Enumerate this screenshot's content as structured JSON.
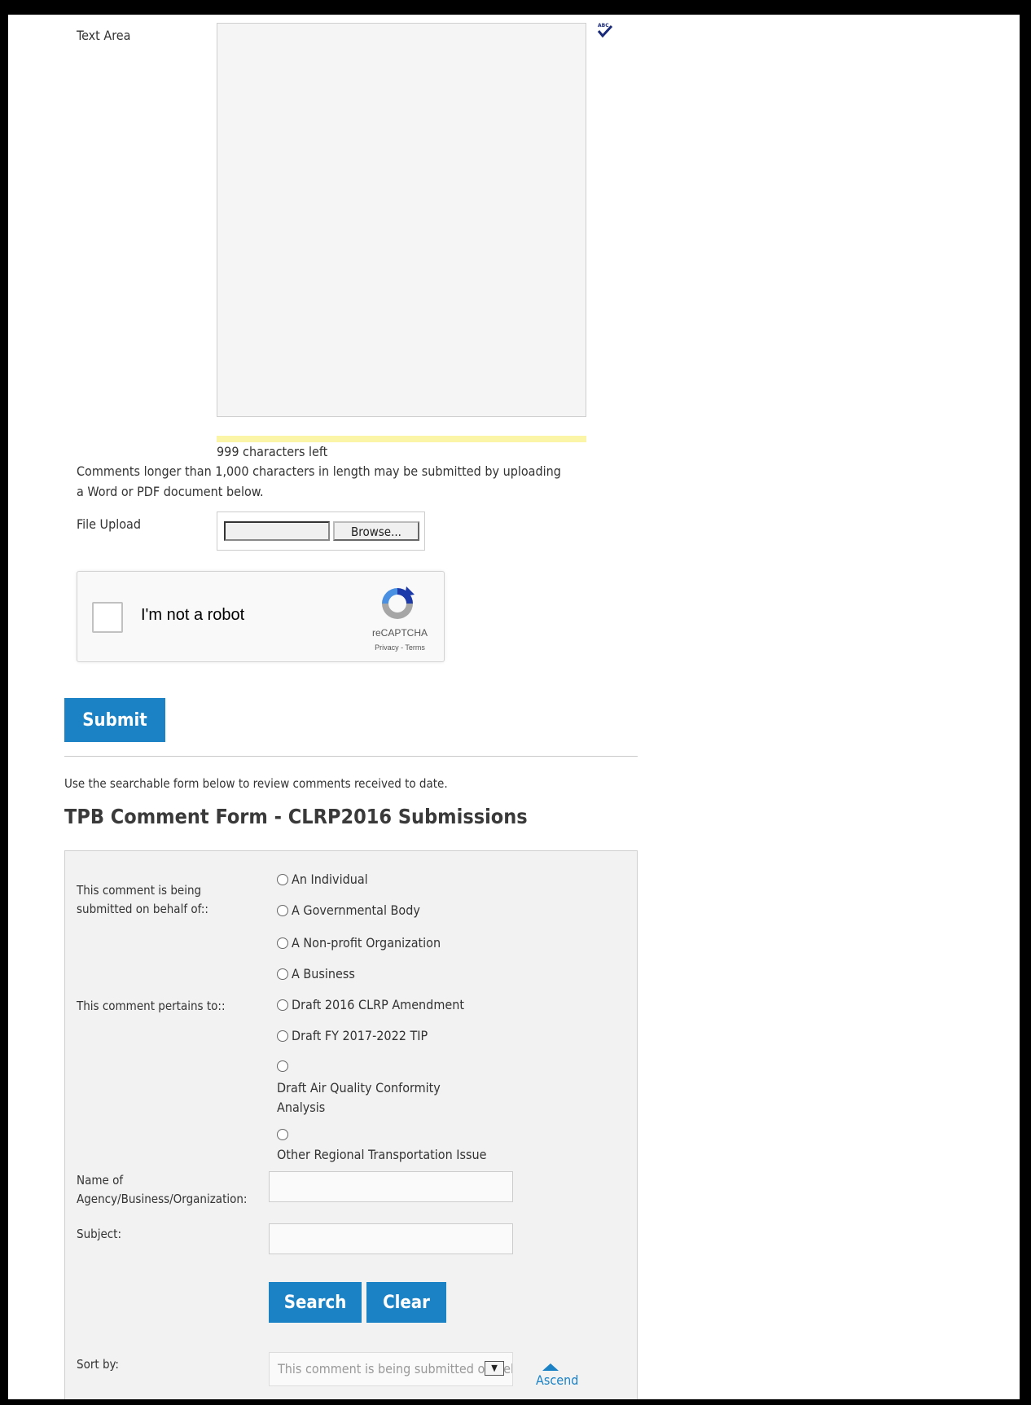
{
  "text_area": {
    "label": "Text Area",
    "value": ""
  },
  "spellcheck_icon": {
    "name": "spellcheck-icon",
    "glyph": "ABC✓"
  },
  "char_counter": "999 characters left",
  "long_comment_note": "Comments longer than 1,000 characters in length may be submitted by uploading a Word or PDF document below.",
  "file_upload": {
    "label": "File Upload",
    "browse_label": "Browse...",
    "value": ""
  },
  "recaptcha": {
    "checkbox_label": "I'm not a robot",
    "brand": "reCAPTCHA",
    "links": "Privacy - Terms"
  },
  "submit_label": "Submit",
  "review_text": "Use the searchable form below to review comments received to date.",
  "search_form": {
    "title": "TPB Comment Form - CLRP2016 Submissions",
    "behalf_label": "This comment is being submitted on behalf of::",
    "behalf_options": [
      "An Individual",
      "A Governmental Body",
      "A Non-profit Organization",
      "A Business"
    ],
    "pertains_label": "This comment pertains to::",
    "pertains_options": [
      "Draft 2016 CLRP Amendment",
      "Draft FY 2017-2022 TIP",
      "Draft Air Quality Conformity Analysis",
      "Other Regional Transportation Issue"
    ],
    "agency_label": "Name of Agency/Business/Organization:",
    "agency_value": "",
    "subject_label": "Subject:",
    "subject_value": "",
    "search_label": "Search",
    "clear_label": "Clear",
    "sort_label": "Sort by:",
    "sort_selected": "This comment is being submitted on behalf of::",
    "ascend_label": "Ascend"
  },
  "colors": {
    "accent": "#1a82c5",
    "counter_bar": "#fbf5a8",
    "panel_bg": "#f2f2f2"
  }
}
